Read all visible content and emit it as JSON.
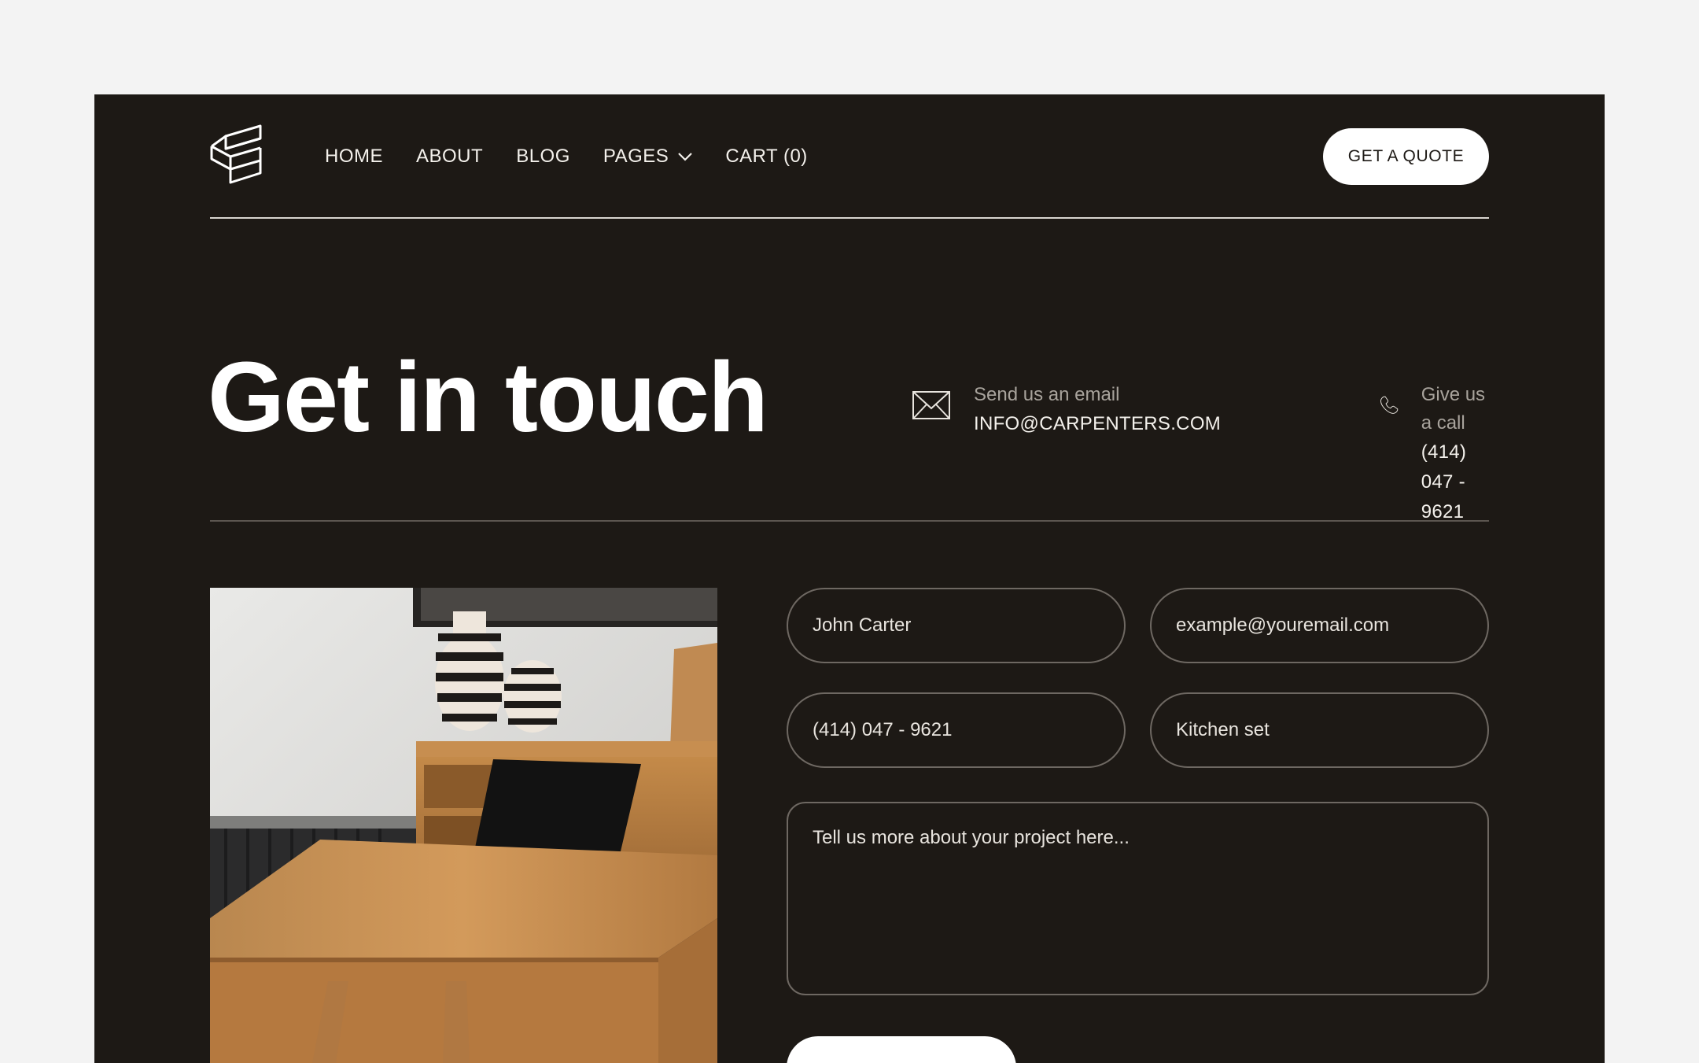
{
  "nav": {
    "links": [
      "HOME",
      "ABOUT",
      "BLOG",
      "PAGES",
      "CART (0)"
    ],
    "cta": "GET A QUOTE"
  },
  "hero": {
    "title": "Get in touch",
    "email_label": "Send us an email",
    "email_value": "INFO@CARPENTERS.COM",
    "call_label": "Give us a call",
    "call_value": "(414) 047 - 9621"
  },
  "form": {
    "name": "John Carter",
    "email": "example@youremail.com",
    "phone": "(414) 047 - 9621",
    "service": "Kitchen set",
    "message_placeholder": "Tell us more about your project here..."
  },
  "icons": {
    "logo": "stacked-panels-logo",
    "email": "envelope-icon",
    "call": "phone-icon",
    "dropdown": "chevron-down-icon"
  },
  "colors": {
    "background": "#1d1915",
    "page": "#f3f3f3",
    "text": "#f4f1ec",
    "muted": "#a8a39c",
    "button": "#ffffff"
  }
}
